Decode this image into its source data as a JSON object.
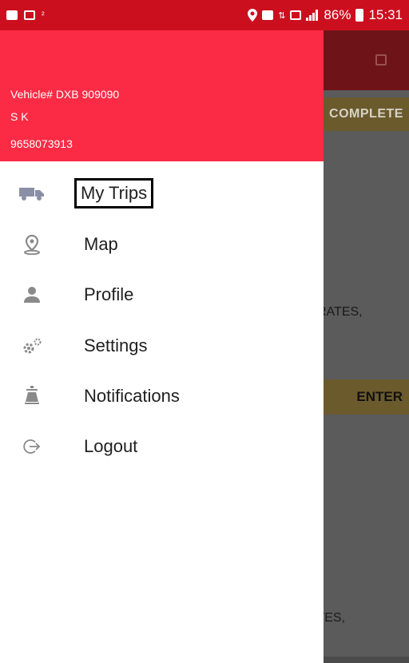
{
  "status_bar": {
    "battery": "86%",
    "time": "15:31"
  },
  "background": {
    "button_top": "COMPLETE",
    "text_1": "RATES,",
    "button_enter": "ENTER",
    "text_2": "ATES,"
  },
  "drawer": {
    "vehicle": "Vehicle# DXB 909090",
    "name": "S K",
    "phone": "9658073913",
    "items": [
      {
        "label": "My Trips",
        "icon": "truck-icon"
      },
      {
        "label": "Map",
        "icon": "map-pin-icon"
      },
      {
        "label": "Profile",
        "icon": "person-icon"
      },
      {
        "label": "Settings",
        "icon": "gears-icon"
      },
      {
        "label": "Notifications",
        "icon": "bell-icon"
      },
      {
        "label": "Logout",
        "icon": "logout-icon"
      }
    ]
  }
}
